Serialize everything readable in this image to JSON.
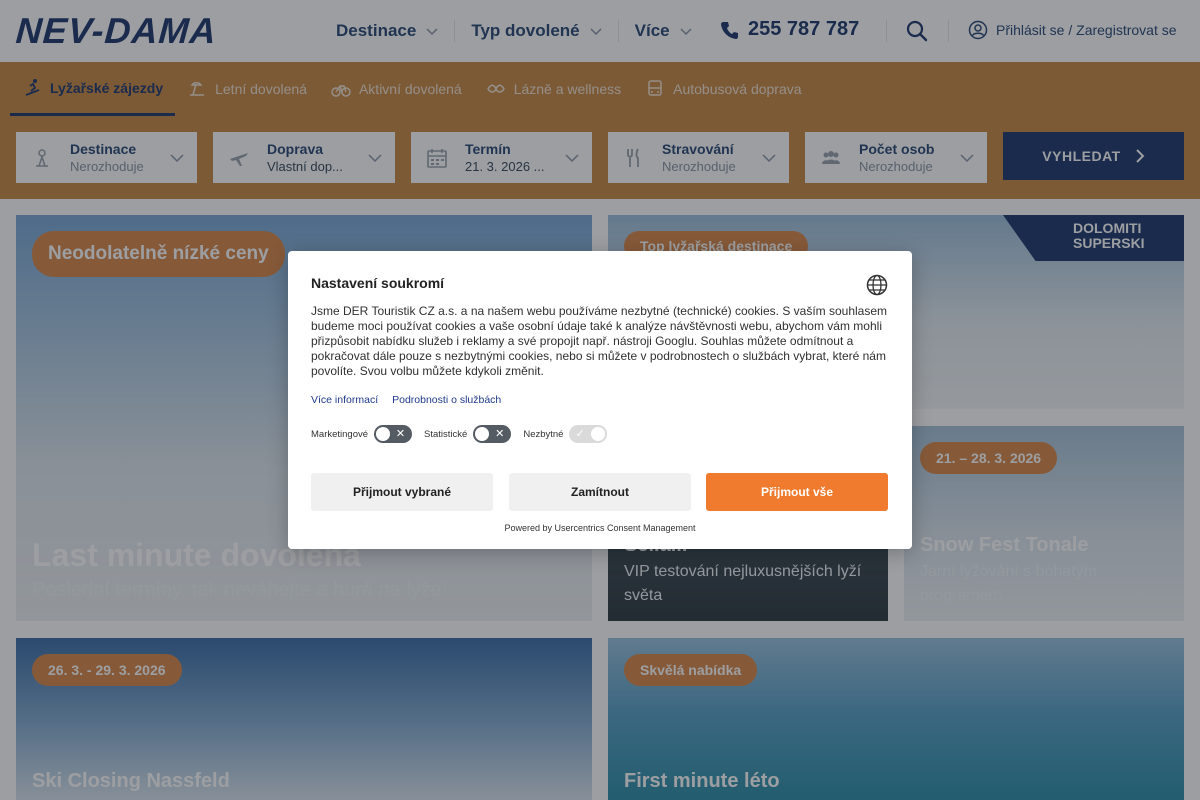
{
  "header": {
    "logo": "NEV-DAMA",
    "nav": [
      {
        "label": "Destinace"
      },
      {
        "label": "Typ dovolené"
      },
      {
        "label": "Více"
      }
    ],
    "phone": "255 787 787",
    "login": "Přihlásit se / Zaregistrovat se"
  },
  "tabs": [
    {
      "label": "Lyžařské zájezdy",
      "icon": "skier-icon",
      "active": true
    },
    {
      "label": "Letní dovolená",
      "icon": "beach-icon"
    },
    {
      "label": "Aktivní dovolená",
      "icon": "bike-icon"
    },
    {
      "label": "Lázně a wellness",
      "icon": "spa-icon"
    },
    {
      "label": "Autobusová doprava",
      "icon": "bus-icon"
    }
  ],
  "search": {
    "fields": [
      {
        "label": "Destinace",
        "value": "Nerozhoduje",
        "icon": "destination-icon"
      },
      {
        "label": "Doprava",
        "value": "Vlastní dop...",
        "icon": "plane-icon"
      },
      {
        "label": "Termín",
        "value": "21. 3. 2026 ...",
        "icon": "calendar-icon"
      },
      {
        "label": "Stravování",
        "value": "Nerozhoduje",
        "icon": "food-icon"
      },
      {
        "label": "Počet osob",
        "value": "Nerozhoduje",
        "icon": "people-icon"
      }
    ],
    "button": "VYHLEDAT"
  },
  "cards": {
    "c1": {
      "badge": "Neodolatelně nízké ceny",
      "title": "Last minute dovolená",
      "sub": "Poslední termíny, tak neváhejte a hurá na lyže!"
    },
    "c2": {
      "badge": "Top lyžařská destinace",
      "logo": "DOLOMITI SUPERSKI"
    },
    "c3": {
      "title": "Sella...",
      "sub": "VIP testování nejluxusnějších lyží světa"
    },
    "c4": {
      "badge": "21. – 28. 3. 2026",
      "title": "Snow Fest Tonale",
      "sub": "Jarní lyžování s bohatým programem"
    },
    "c5": {
      "badge": "26. 3. - 29. 3. 2026",
      "title": "Ski Closing Nassfeld"
    },
    "c6": {
      "badge": "Skvělá nabídka",
      "title": "First minute léto"
    }
  },
  "modal": {
    "title": "Nastavení soukromí",
    "body": "Jsme DER Touristik CZ a.s. a na našem webu používáme nezbytné (technické) cookies. S vaším souhlasem budeme moci používat cookies a vaše osobní údaje také k analýze návštěvnosti webu, abychom vám mohli přizpůsobit nabídku služeb i reklamy a své propojit např. nástroji Googlu. Souhlas můžete odmítnout a pokračovat dále pouze s nezbytnými cookies, nebo si můžete v podrobnostech o službách vybrat, které nám povolíte. Svou volbu můžete kdykoli změnit.",
    "links": [
      "Více informací",
      "Podrobnosti o službách"
    ],
    "toggles": [
      {
        "label": "Marketingové",
        "state": "off"
      },
      {
        "label": "Statistické",
        "state": "off"
      },
      {
        "label": "Nezbytné",
        "state": "on-disabled"
      }
    ],
    "buttons": {
      "accept_selected": "Přijmout vybrané",
      "reject": "Zamítnout",
      "accept_all": "Přijmout vše"
    },
    "powered": "Powered by Usercentrics Consent Management"
  },
  "colors": {
    "brand": "#1f3a6e",
    "band": "#c98a48",
    "accent": "#f07a2e"
  }
}
